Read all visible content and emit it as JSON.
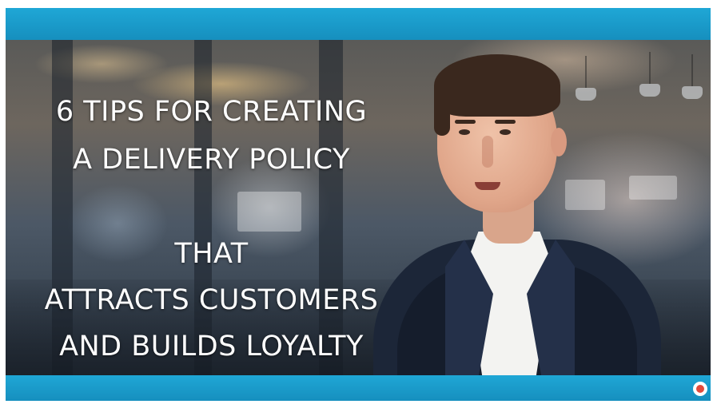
{
  "video": {
    "title_lines": [
      "6 TIPS FOR CREATING",
      "A DELIVERY POLICY",
      "THAT",
      "ATTRACTS CUSTOMERS",
      "AND BUILDS LOYALTY"
    ]
  },
  "colors": {
    "frame_bar": "#1fa7d6",
    "text": "#ffffff"
  },
  "icons": {
    "corner_logo": "channel-logo-icon"
  }
}
